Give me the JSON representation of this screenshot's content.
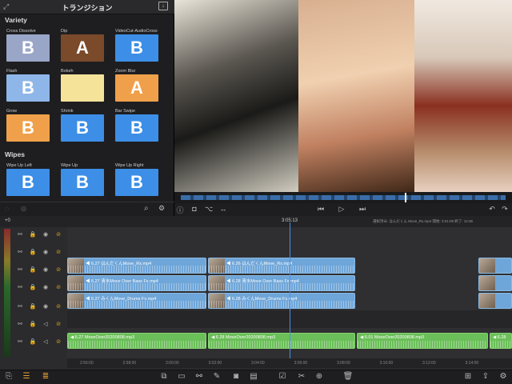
{
  "panel": {
    "title": "トランジション",
    "sections": [
      {
        "name": "Variety",
        "tiles": [
          {
            "label": "Cross Dissolve",
            "letter": "B",
            "bg": "#9aa6c8"
          },
          {
            "label": "Dip",
            "letter": "A",
            "bg": "#7a4a2a"
          },
          {
            "label": "VideoCut-AudioCross",
            "letter": "B",
            "bg": "#3c8ee6"
          },
          {
            "label": "Flash",
            "letter": "B",
            "bg": "#8fb6e8"
          },
          {
            "label": "Bokeh",
            "letter": "",
            "bg": "#f5e39a"
          },
          {
            "label": "Zoom Blur",
            "letter": "A",
            "bg": "#f0a04a"
          },
          {
            "label": "Grow",
            "letter": "B",
            "bg": "#f0a04a"
          },
          {
            "label": "Shrink",
            "letter": "B",
            "bg": "#3c8ee6"
          },
          {
            "label": "Bar Swipe",
            "letter": "B",
            "bg": "#3c8ee6"
          }
        ]
      },
      {
        "name": "Wipes",
        "tiles": [
          {
            "label": "Wipe Up Left",
            "letter": "B",
            "bg": "#3c8ee6"
          },
          {
            "label": "Wipe Up",
            "letter": "B",
            "bg": "#3c8ee6"
          },
          {
            "label": "Wipe Up Right",
            "letter": "B",
            "bg": "#3c8ee6"
          }
        ]
      }
    ]
  },
  "timeline": {
    "playhead_time": "3:05:13",
    "selection_info": "選択済み: ほんだくん Move_Rx.mp4  開始: 3:01:08  終了: 12:36",
    "zero_label": "+0",
    "ruler_ticks": [
      "2:56:00",
      "2:58:00",
      "3:00:00",
      "3:02:00",
      "3:04:00",
      "3:06:00",
      "3:08:00",
      "3:10:00",
      "3:12:00",
      "3:14:00"
    ],
    "blue_tracks": [
      {
        "clips": [
          {
            "text": "◀ 6.27  はんだくんMove_Rx.mp4"
          },
          {
            "text": "◀ 6.26  はんだくんMove_Rx.mp4"
          }
        ]
      },
      {
        "clips": [
          {
            "text": "◀ 6.27  清水Move Over Bass Fx.mp4"
          },
          {
            "text": "◀ 6.28  清水Move Over Bass Fx.mp4"
          }
        ]
      },
      {
        "clips": [
          {
            "text": "◀ 6.27  みくんMove_Drums Fx.mp4"
          },
          {
            "text": "◀ 6.28  みくんMove_Drums Fx.mp4"
          }
        ]
      }
    ],
    "green_clips": [
      {
        "text": "◀ 6.27  MoveOver20200808.mp3"
      },
      {
        "text": "◀ 6.28  MoveOver20200808.mp3"
      },
      {
        "text": "◀ 6.01  MoveOver20200808.mp3"
      },
      {
        "text": "◀ 6.28"
      }
    ]
  },
  "colors": {
    "accent": "#4a90e2",
    "audio": "#6bbf59",
    "video": "#6fa6d9"
  }
}
